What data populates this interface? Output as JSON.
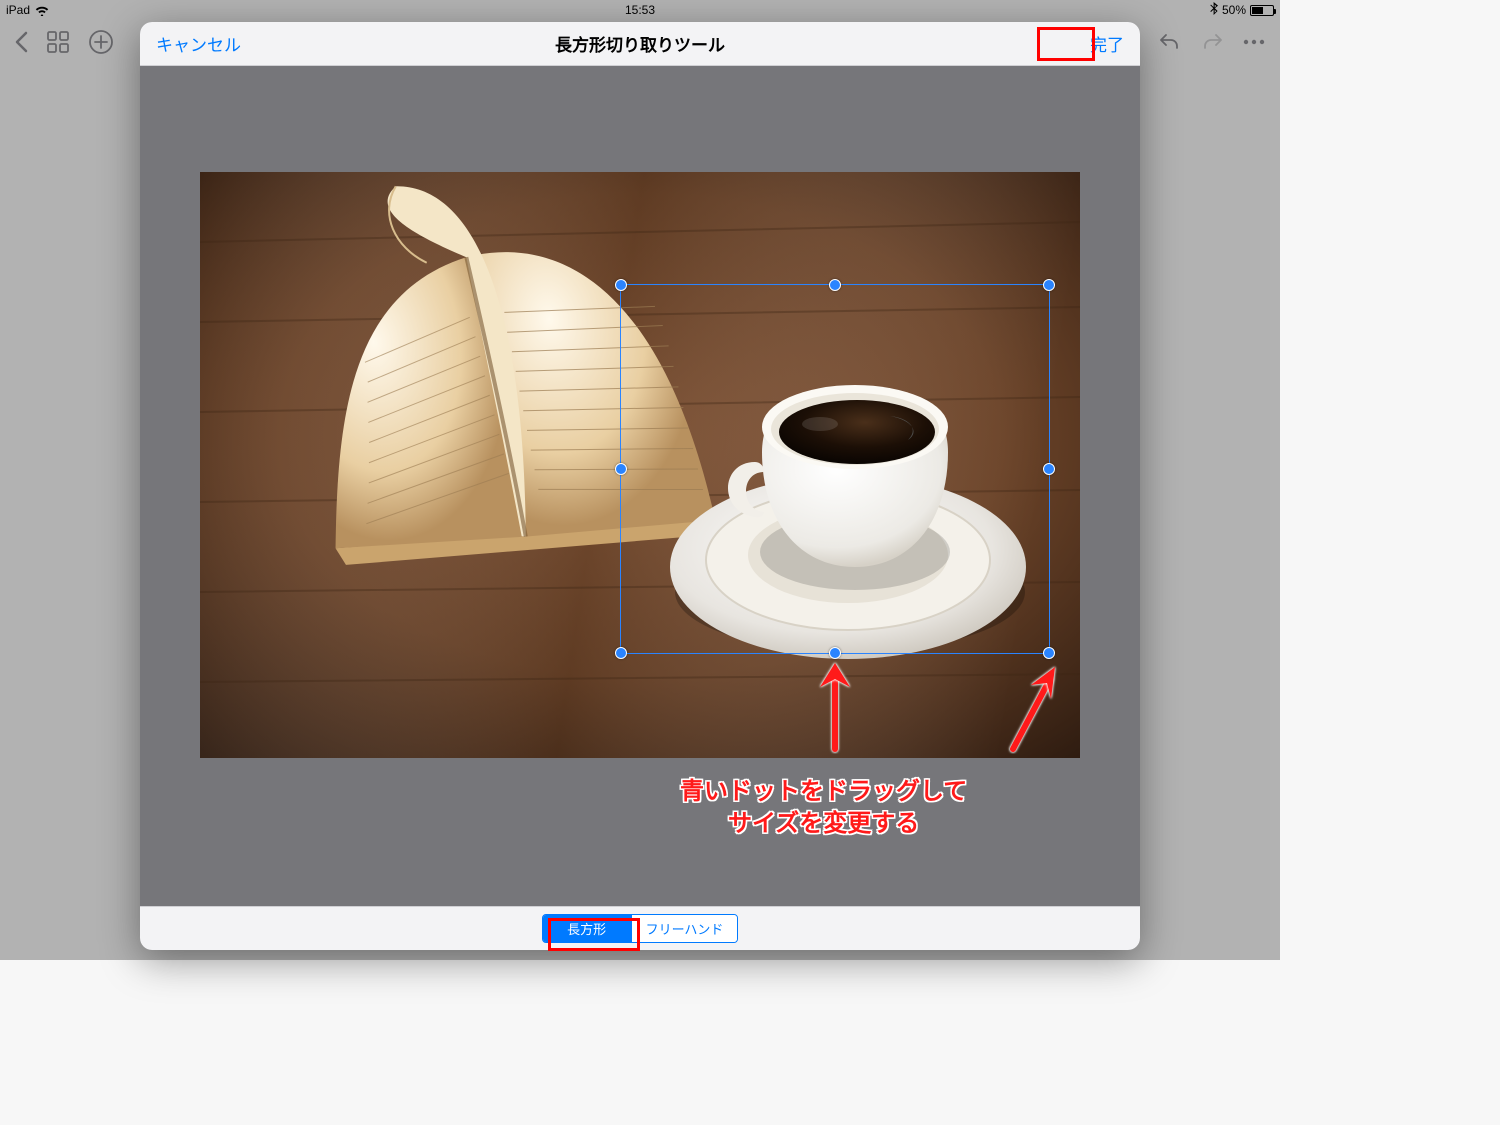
{
  "status": {
    "device": "iPad",
    "time": "15:53",
    "battery_pct": "50%"
  },
  "sheet": {
    "cancel": "キャンセル",
    "title": "長方形切り取りツール",
    "done": "完了"
  },
  "segments": {
    "rect": "長方形",
    "freehand": "フリーハンド"
  },
  "annotation": {
    "line1": "青いドットをドラッグして",
    "line2": "サイズを変更する"
  }
}
